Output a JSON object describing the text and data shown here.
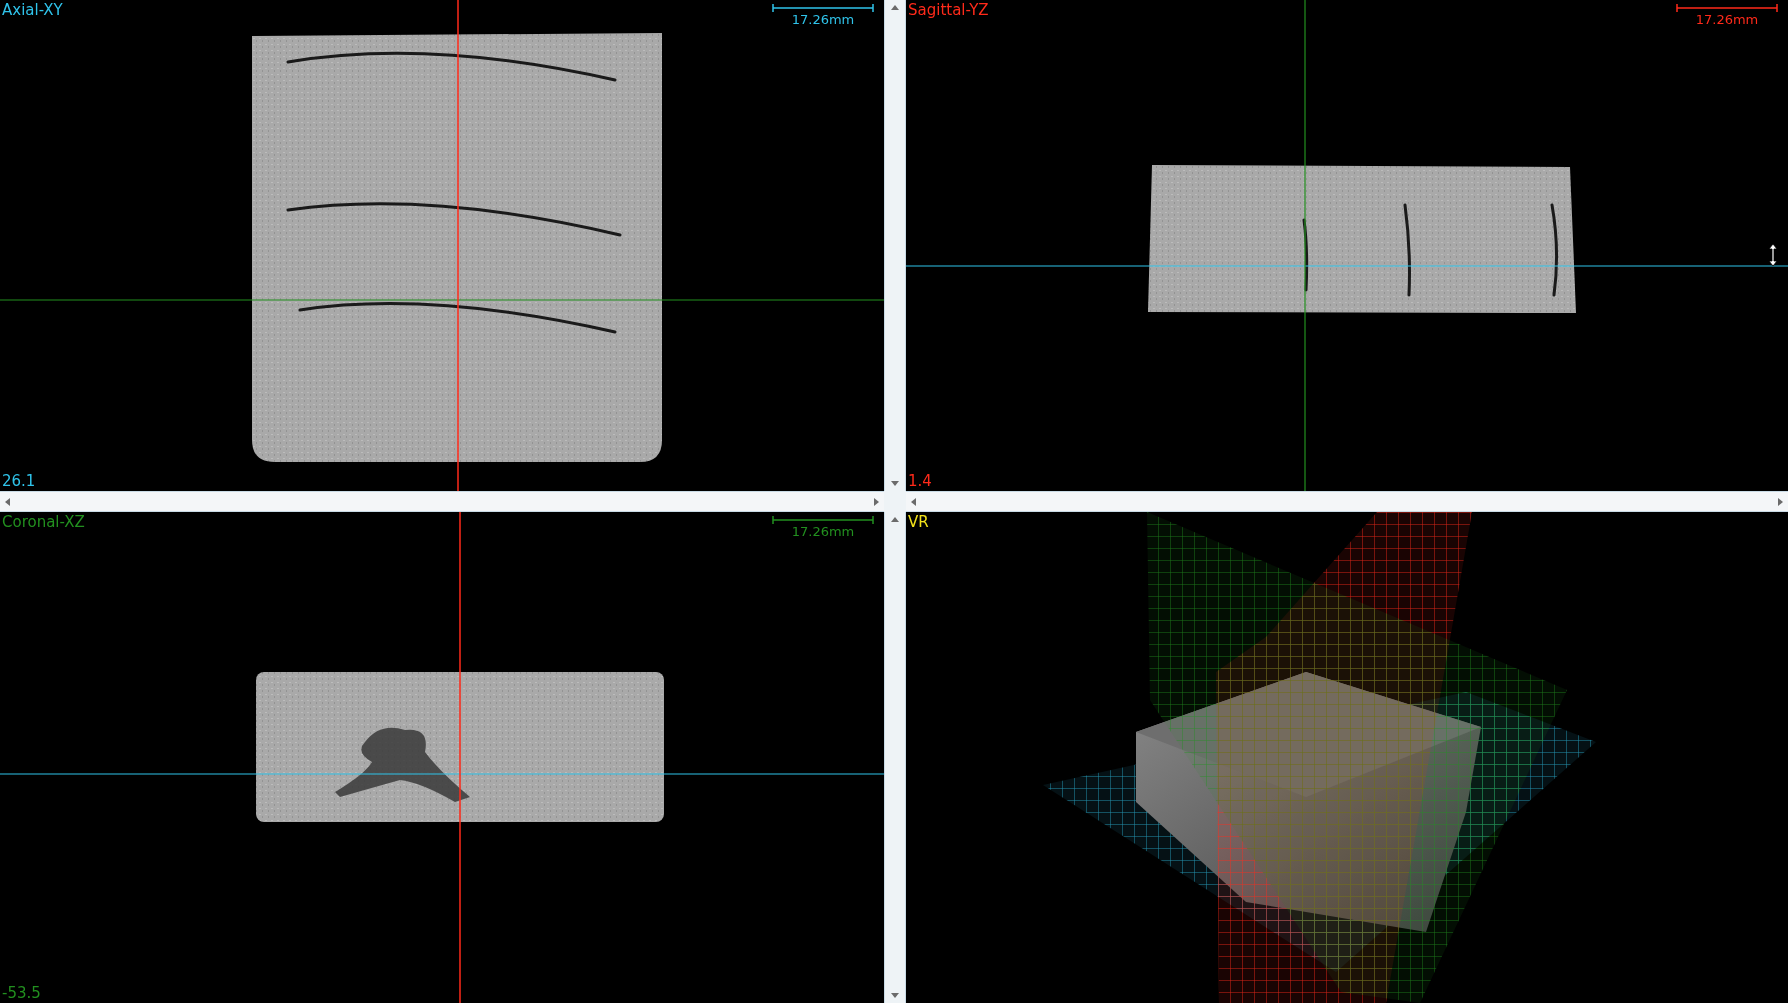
{
  "viewports": [
    {
      "kind": "axial",
      "label": "Axial-XY",
      "color": "#2fc3ea",
      "scale": "17.26mm",
      "slice": "26.1"
    },
    {
      "kind": "sagittal",
      "label": "Sagittal-YZ",
      "color": "#ff2a1a",
      "scale": "17.26mm",
      "slice": "1.4"
    },
    {
      "kind": "coronal",
      "label": "Coronal-XZ",
      "color": "#22901f",
      "scale": "17.26mm",
      "slice": "-53.5"
    },
    {
      "kind": "volume",
      "label": "VR",
      "color": "#f2e21a"
    }
  ]
}
